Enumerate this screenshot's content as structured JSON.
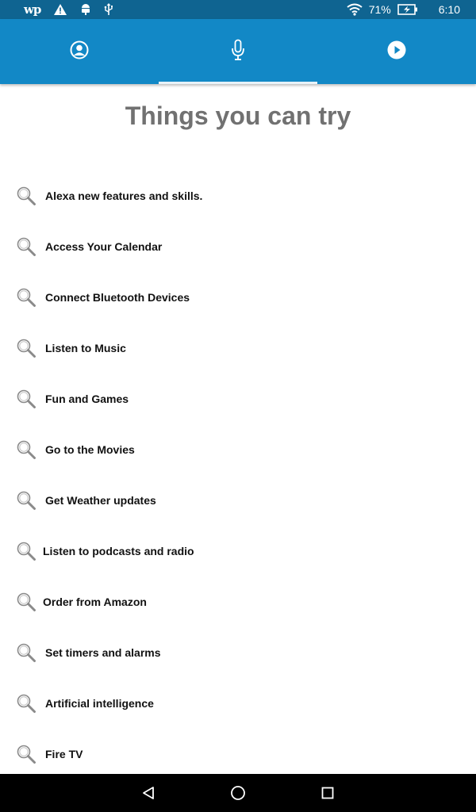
{
  "status_bar": {
    "app_icon_text": "wp",
    "wifi_icon": "wifi-icon",
    "battery_percent": "71%",
    "time": "6:10"
  },
  "nav_tabs": [
    {
      "icon": "profile-icon",
      "active": false
    },
    {
      "icon": "microphone-icon",
      "active": true
    },
    {
      "icon": "play-icon",
      "active": false
    }
  ],
  "main": {
    "title": "Things you can try",
    "items": [
      {
        "label": "Alexa new features and skills."
      },
      {
        "label": "Access Your Calendar"
      },
      {
        "label": "Connect Bluetooth Devices"
      },
      {
        "label": "Listen to Music"
      },
      {
        "label": "Fun and Games"
      },
      {
        "label": "Go to the Movies"
      },
      {
        "label": "Get Weather updates"
      },
      {
        "label": "Listen to podcasts and radio"
      },
      {
        "label": "Order from Amazon"
      },
      {
        "label": "Set timers and alarms"
      },
      {
        "label": "Artificial intelligence"
      },
      {
        "label": "Fire TV"
      }
    ]
  },
  "colors": {
    "status_bar_bg": "#0f6491",
    "top_nav_bg": "#1288c6",
    "title_text": "#717171",
    "nav_bar_bg": "#000000"
  }
}
